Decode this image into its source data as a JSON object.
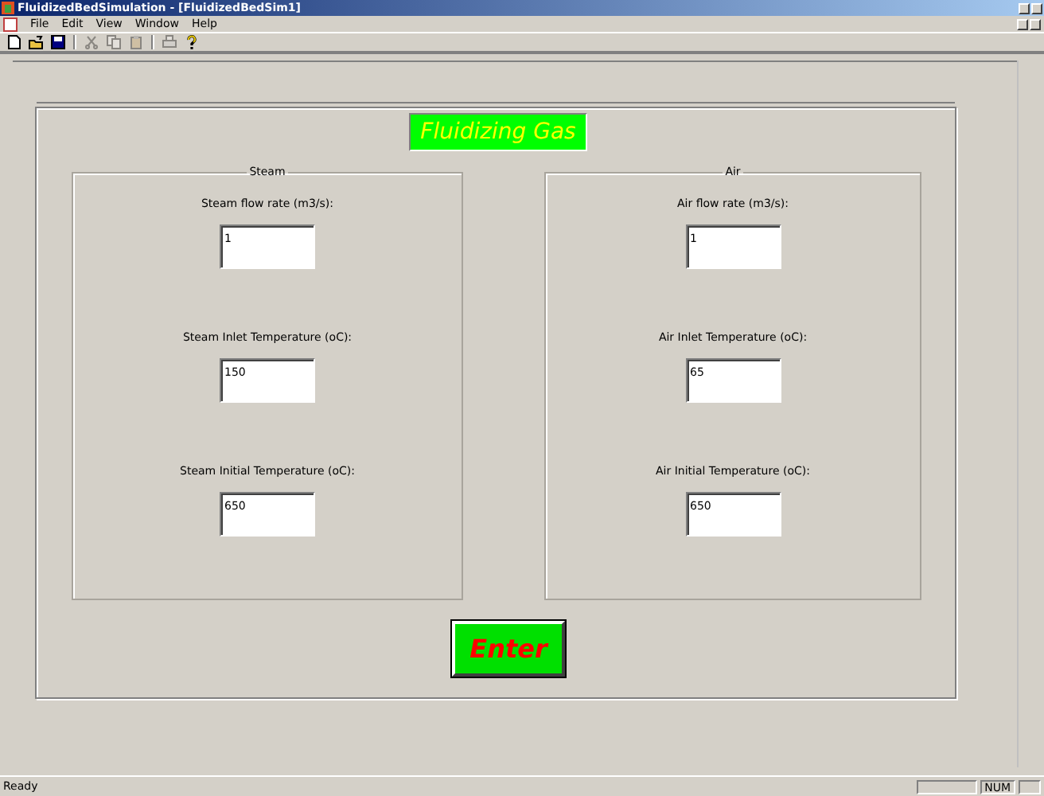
{
  "window": {
    "title": "FluidizedBedSimulation - [FluidizedBedSim1]"
  },
  "menu": [
    "File",
    "Edit",
    "View",
    "Window",
    "Help"
  ],
  "toolbar": [
    {
      "kind": "new",
      "disabled": false
    },
    {
      "kind": "open",
      "disabled": false
    },
    {
      "kind": "save",
      "disabled": false
    },
    {
      "kind": "cut",
      "disabled": true
    },
    {
      "kind": "copy",
      "disabled": true
    },
    {
      "kind": "paste",
      "disabled": true
    },
    {
      "kind": "print",
      "disabled": true
    },
    {
      "kind": "help",
      "disabled": false
    }
  ],
  "form": {
    "title": "Fluidizing Gas",
    "groups": [
      {
        "title": "Steam",
        "fields": [
          {
            "label": "Steam flow rate (m3/s):",
            "value": "1"
          },
          {
            "label": "Steam Inlet Temperature (oC):",
            "value": "150"
          },
          {
            "label": "Steam Initial Temperature (oC):",
            "value": "650"
          }
        ]
      },
      {
        "title": "Air",
        "fields": [
          {
            "label": "Air flow rate (m3/s):",
            "value": "1"
          },
          {
            "label": "Air Inlet Temperature (oC):",
            "value": "65"
          },
          {
            "label": "Air Initial Temperature (oC):",
            "value": "650"
          }
        ]
      }
    ],
    "enter_button": "Enter"
  },
  "status_bar": {
    "text": "Ready",
    "num_indicator": "NUM"
  }
}
